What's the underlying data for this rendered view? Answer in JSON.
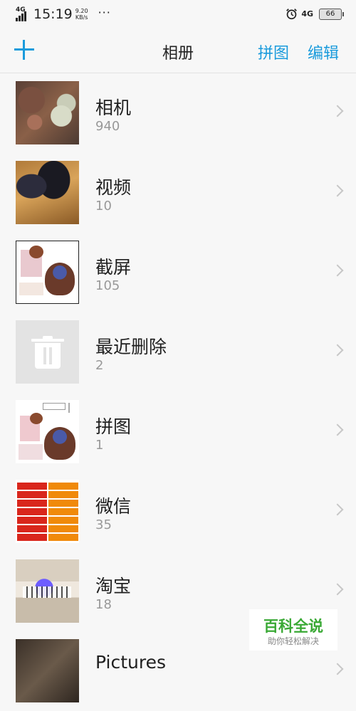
{
  "status_bar": {
    "network_type": "4G",
    "time": "15:19",
    "speed_value": "9.20",
    "speed_unit": "KB/s",
    "more": "···",
    "right_network": "4G",
    "battery": "66"
  },
  "header": {
    "title": "相册",
    "collage_label": "拼图",
    "edit_label": "编辑",
    "add_icon": "plus-icon"
  },
  "albums": [
    {
      "name": "相机",
      "count": "940"
    },
    {
      "name": "视频",
      "count": "10"
    },
    {
      "name": "截屏",
      "count": "105"
    },
    {
      "name": "最近删除",
      "count": "2"
    },
    {
      "name": "拼图",
      "count": "1"
    },
    {
      "name": "微信",
      "count": "35"
    },
    {
      "name": "淘宝",
      "count": "18"
    },
    {
      "name": "Pictures",
      "count": ""
    }
  ],
  "watermark": {
    "title": "百科全说",
    "subtitle": "助你轻松解决"
  },
  "colors": {
    "accent": "#1a9bdc",
    "watermark_green": "#3aa935"
  }
}
